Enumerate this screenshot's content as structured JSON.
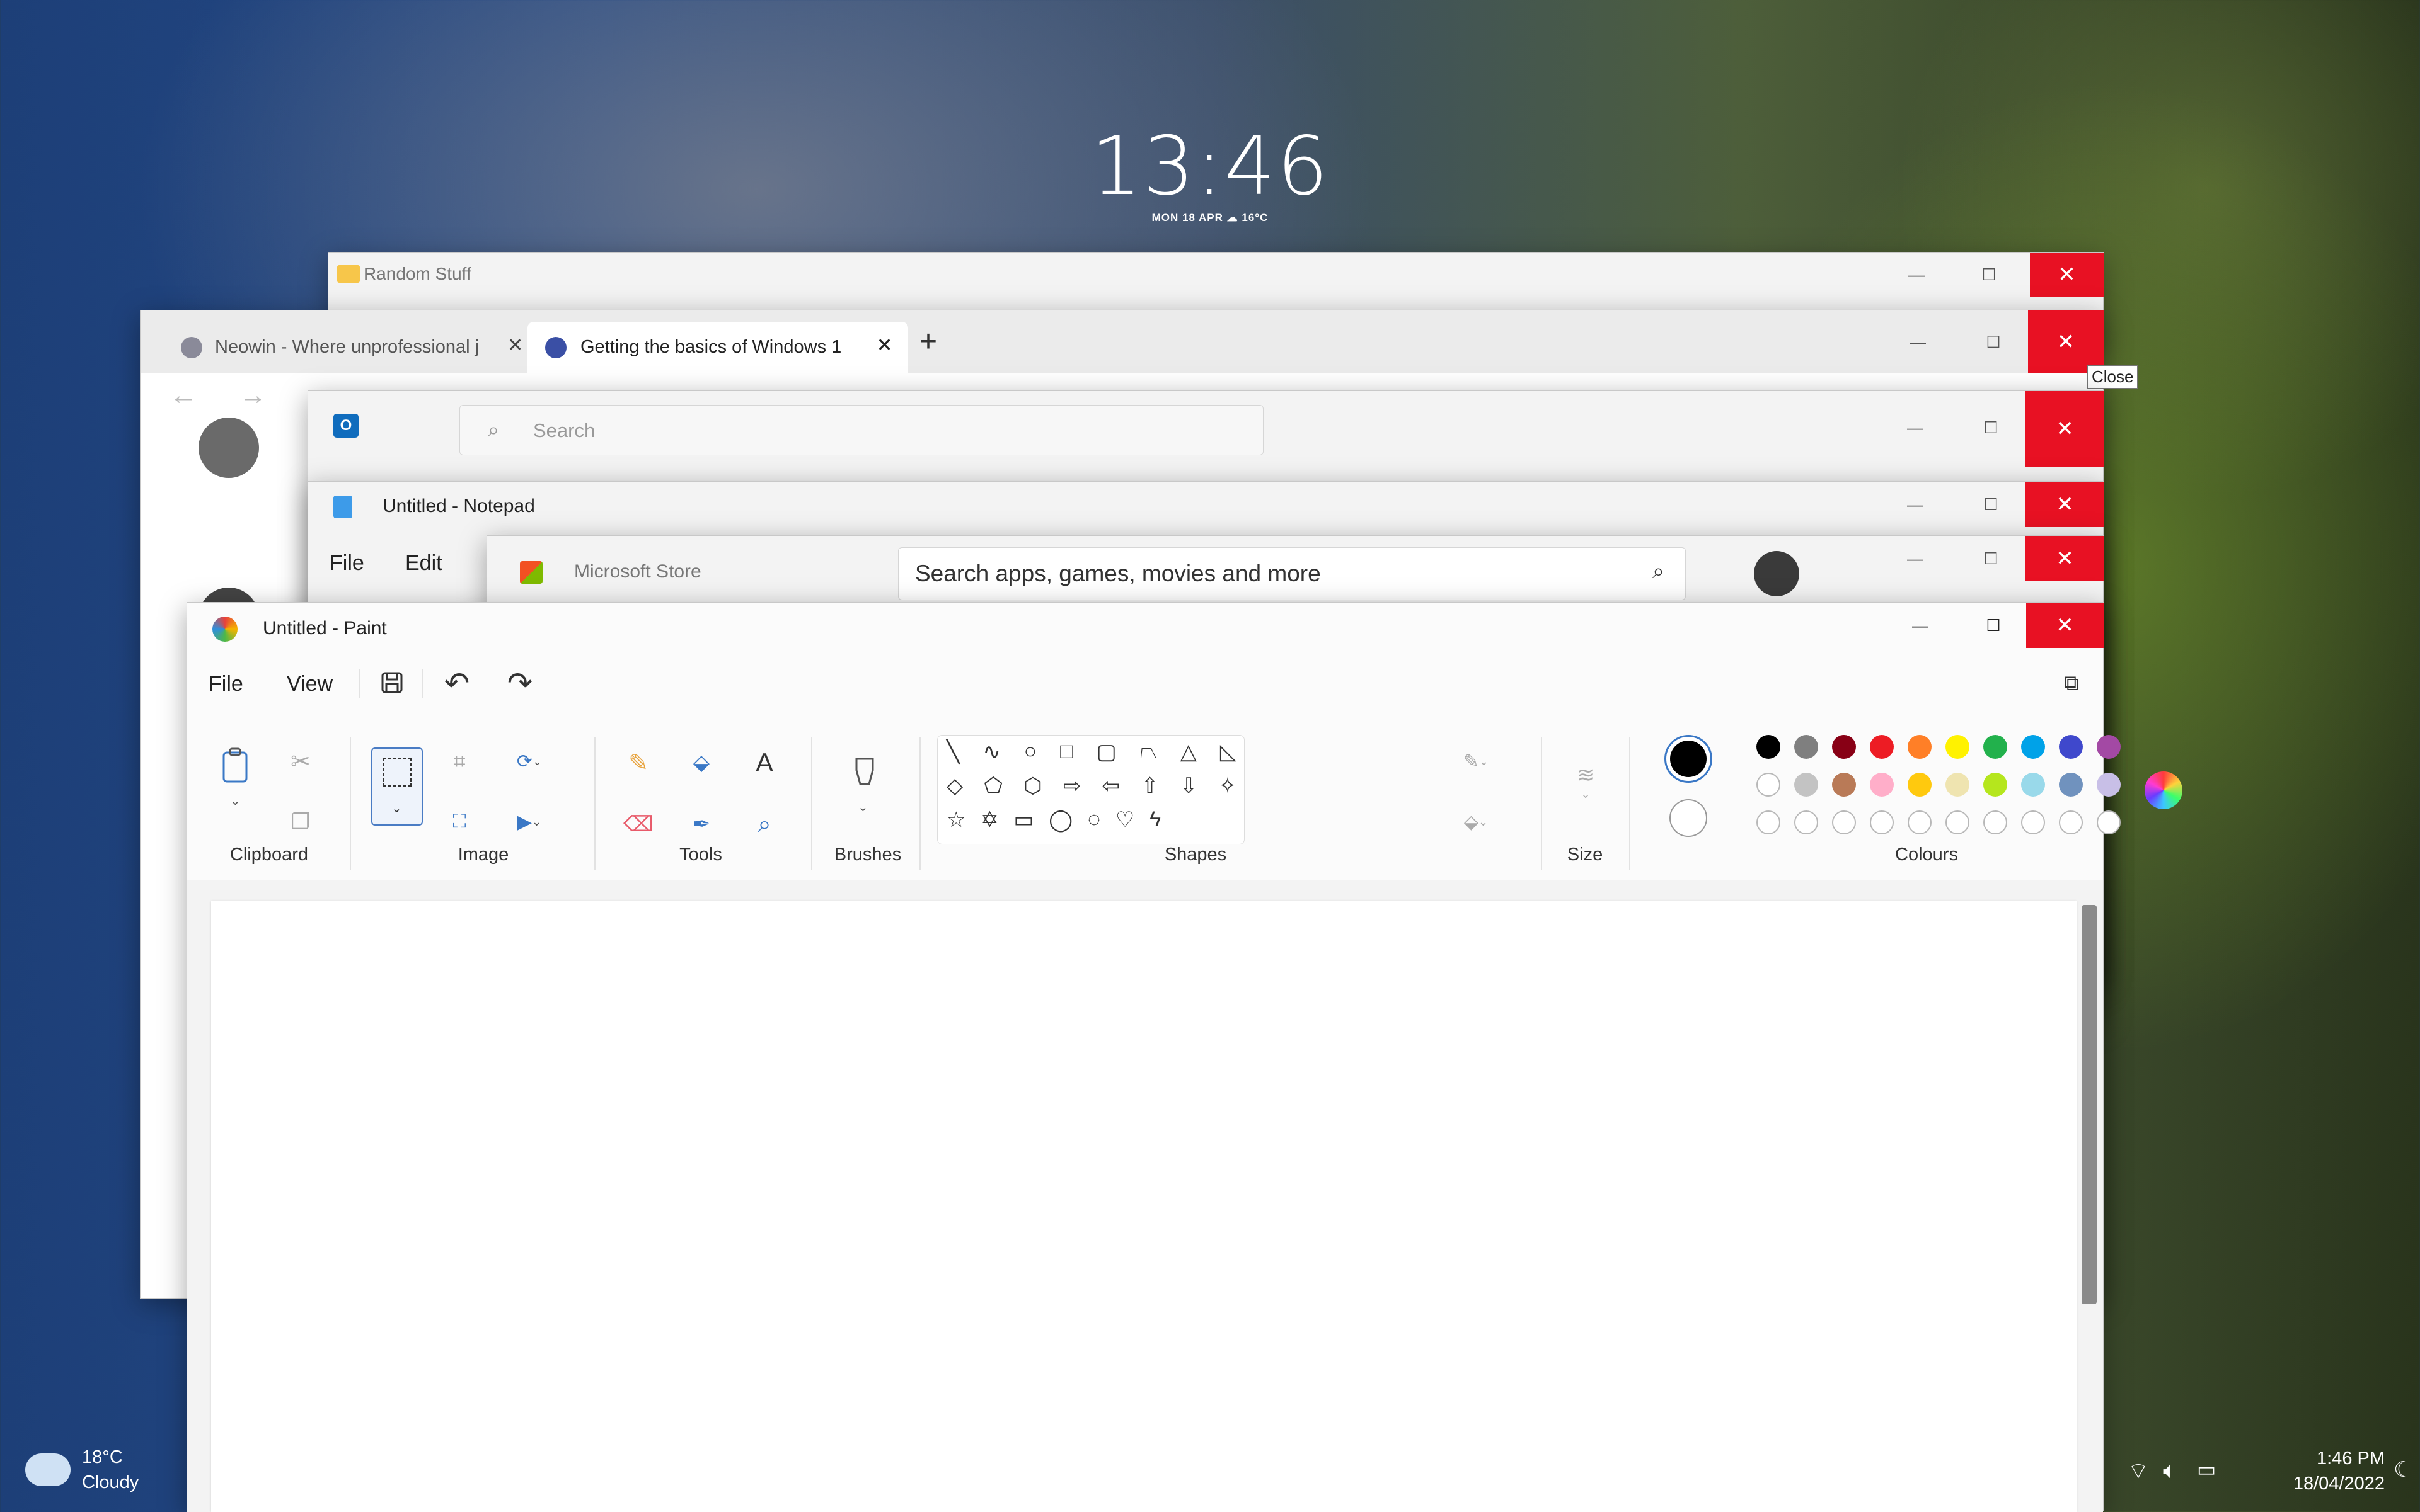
{
  "lockscreen": {
    "time": "13:46",
    "date_weather": "MON 18 APR  ☁  16°C"
  },
  "explorer": {
    "title": "Random Stuff"
  },
  "browser": {
    "tabs": [
      {
        "label": "Neowin - Where unprofessional j"
      },
      {
        "label": "Getting the basics of Windows 1"
      }
    ],
    "new_tab": "+",
    "tooltip": "Close"
  },
  "outlook": {
    "search_placeholder": "Search"
  },
  "notepad": {
    "title": "Untitled - Notepad",
    "menu": [
      "File",
      "Edit"
    ]
  },
  "store": {
    "title": "Microsoft Store",
    "search_placeholder": "Search apps, games, movies and more"
  },
  "paint": {
    "title": "Untitled - Paint",
    "menu": {
      "file": "File",
      "view": "View"
    },
    "groups": {
      "clipboard": "Clipboard",
      "image": "Image",
      "tools": "Tools",
      "brushes": "Brushes",
      "shapes": "Shapes",
      "size": "Size",
      "colours": "Colours"
    },
    "palette_row1": [
      "#000000",
      "#7f7f7f",
      "#880015",
      "#ed1c24",
      "#ff7f27",
      "#fff200",
      "#22b14c",
      "#00a2e8",
      "#3f48cc",
      "#a349a4"
    ],
    "palette_row2": [
      "#ffffff",
      "#c3c3c3",
      "#b97a57",
      "#ffaec9",
      "#ffc90e",
      "#efe4b0",
      "#b5e61d",
      "#99d9ea",
      "#7092be",
      "#c8bfe7"
    ],
    "primary_color": "#000000",
    "secondary_color": "#ffffff"
  },
  "taskbar": {
    "weather_temp": "18°C",
    "weather_desc": "Cloudy",
    "time": "1:46 PM",
    "date": "18/04/2022"
  }
}
